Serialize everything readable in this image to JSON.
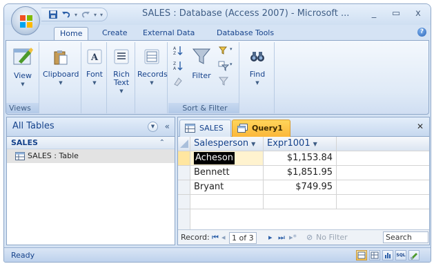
{
  "window": {
    "title": "SALES : Database (Access 2007) - Microsoft ...",
    "controls": {
      "minimize": "_",
      "maximize": "▭",
      "close": "x"
    }
  },
  "ribbon": {
    "tabs": [
      "Home",
      "Create",
      "External Data",
      "Database Tools"
    ],
    "active_tab": "Home",
    "groups": {
      "views": {
        "label": "Views",
        "view_label": "View"
      },
      "clipboard": {
        "label": "Clipboard"
      },
      "font": {
        "label": "Font"
      },
      "rich_text": {
        "label": "Rich Text"
      },
      "records": {
        "label": "Records"
      },
      "sort_filter": {
        "label": "Sort & Filter",
        "filter_label": "Filter"
      },
      "find": {
        "label": "Find"
      }
    }
  },
  "nav_pane": {
    "header": "All Tables",
    "group": "SALES",
    "items": [
      {
        "label": "SALES : Table"
      }
    ]
  },
  "document": {
    "tabs": [
      {
        "label": "SALES",
        "active": false
      },
      {
        "label": "Query1",
        "active": true
      }
    ],
    "grid": {
      "columns": [
        "Salesperson",
        "Expr1001"
      ],
      "rows": [
        [
          "Acheson",
          "$1,153.84"
        ],
        [
          "Bennett",
          "$1,851.95"
        ],
        [
          "Bryant",
          "$749.95"
        ]
      ]
    },
    "record_nav": {
      "label": "Record:",
      "position": "1 of 3",
      "filter": "No Filter",
      "search": "Search"
    }
  },
  "status_bar": {
    "text": "Ready",
    "view_sql": "SQL"
  },
  "colors": {
    "accent_tab": "#fbb73b",
    "ribbon_text": "#15428b",
    "frame": "#8ea7c8"
  }
}
